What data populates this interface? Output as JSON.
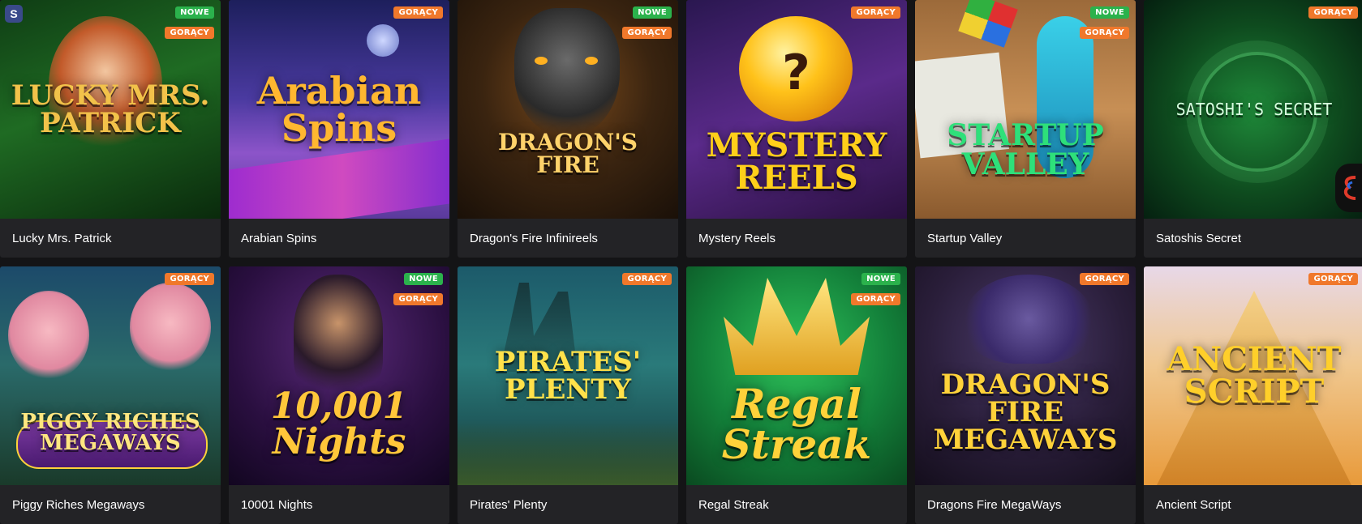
{
  "games": [
    {
      "title": "Lucky Mrs. Patrick",
      "art_text": "LUCKY MRS. PATRICK",
      "badges": [
        "NOWE",
        "GORĄCY"
      ],
      "bg": "linear-gradient(160deg,#0f3d14 0%,#1f6b23 45%,#0a2a0c 100%)",
      "text_color": "#f2c24a",
      "font_size": 34
    },
    {
      "title": "Arabian Spins",
      "art_text": "Arabian Spins",
      "badges": [
        "GORĄCY"
      ],
      "bg": "linear-gradient(180deg,#1d1f5c 0%,#4a3aa0 45%,#8c54c9 70%,#5a3a9c 100%)",
      "text_color": "#ffb730",
      "font_size": 46
    },
    {
      "title": "Dragon's Fire Infinireels",
      "art_text": "DRAGON'S FIRE",
      "badges": [
        "NOWE",
        "GORĄCY"
      ],
      "bg": "radial-gradient(circle at 50% 40%,#7a4a1c 0%,#3a2410 50%,#1a1008 100%)",
      "text_color": "#ffd36b",
      "font_size": 28
    },
    {
      "title": "Mystery Reels",
      "art_text": "MYSTERY REELS",
      "badges": [
        "GORĄCY"
      ],
      "bg": "linear-gradient(160deg,#2a1750 0%,#5a2a8a 50%,#2a1040 100%)",
      "text_color": "#ffcf1a",
      "font_size": 40
    },
    {
      "title": "Startup Valley",
      "art_text": "STARTUP VALLEY",
      "badges": [
        "NOWE",
        "GORĄCY"
      ],
      "bg": "linear-gradient(180deg,#9c6a3a 0%,#c78f55 50%,#8a5a2e 100%)",
      "text_color": "#2ee07a",
      "font_size": 36
    },
    {
      "title": "Satoshis Secret",
      "art_text": "SATOSHI'S SECRET",
      "badges": [
        "GORĄCY"
      ],
      "bg": "radial-gradient(circle at 50% 50%,#1f8a3a 0%,#0e4a1e 55%,#052010 100%)",
      "text_color": "#d8ffe0",
      "font_size": 20
    },
    {
      "title": "Piggy Riches Megaways",
      "art_text": "PIGGY RICHES MEGAWAYS",
      "badges": [
        "GORĄCY"
      ],
      "bg": "linear-gradient(180deg,#1c4a6a 0%,#2a6a6a 45%,#1a3a2a 100%)",
      "text_color": "#ffe680",
      "font_size": 26
    },
    {
      "title": "10001 Nights",
      "art_text": "10,001 Nights",
      "badges": [
        "NOWE",
        "GORĄCY"
      ],
      "bg": "radial-gradient(circle at 50% 35%,#5a2a7a 0%,#2a0f40 60%,#120620 100%)",
      "text_color": "#ffc63a",
      "font_size": 44
    },
    {
      "title": "Pirates' Plenty",
      "art_text": "PIRATES' PLENTY",
      "badges": [
        "GORĄCY"
      ],
      "bg": "linear-gradient(180deg,#1c5a6a 0%,#2a7a7a 45%,#13363a 100%)",
      "text_color": "#ffe14a",
      "font_size": 34
    },
    {
      "title": "Regal Streak",
      "art_text": "Regal Streak",
      "badges": [
        "NOWE",
        "GORĄCY"
      ],
      "bg": "radial-gradient(circle at 50% 40%,#2ec25a 0%,#13803a 55%,#0a4a20 100%)",
      "text_color": "#ffd23a",
      "font_size": 50
    },
    {
      "title": "Dragons Fire MegaWays",
      "art_text": "DRAGON'S FIRE MEGAWAYS",
      "badges": [
        "GORĄCY"
      ],
      "bg": "radial-gradient(circle at 50% 35%,#4a3a6a 0%,#2a1e3a 55%,#140e1c 100%)",
      "text_color": "#ffd23a",
      "font_size": 34
    },
    {
      "title": "Ancient Script",
      "art_text": "ANCIENT SCRIPT",
      "badges": [
        "GORĄCY"
      ],
      "bg": "linear-gradient(180deg,#e8d8e8 0%,#f0c890 45%,#e89a3a 100%)",
      "text_color": "#ffcf2a",
      "font_size": 40
    }
  ]
}
